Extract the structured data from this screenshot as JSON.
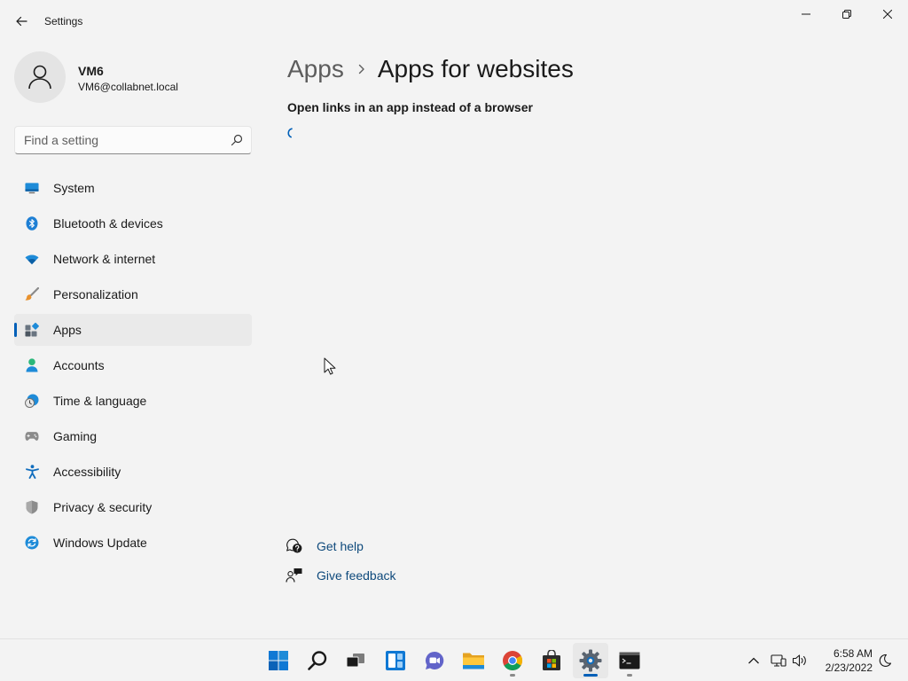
{
  "window": {
    "title": "Settings",
    "back_icon": "arrow-left-icon",
    "controls": [
      "minimize-icon",
      "restore-icon",
      "close-icon"
    ]
  },
  "user": {
    "name": "VM6",
    "email": "VM6@collabnet.local",
    "avatar_icon": "person-icon"
  },
  "search": {
    "placeholder": "Find a setting",
    "icon": "search-icon"
  },
  "sidebar": {
    "selected": "Apps",
    "items": [
      {
        "label": "System",
        "icon": "system-icon"
      },
      {
        "label": "Bluetooth & devices",
        "icon": "bluetooth-icon"
      },
      {
        "label": "Network & internet",
        "icon": "wifi-icon"
      },
      {
        "label": "Personalization",
        "icon": "brush-icon"
      },
      {
        "label": "Apps",
        "icon": "apps-icon"
      },
      {
        "label": "Accounts",
        "icon": "accounts-icon"
      },
      {
        "label": "Time & language",
        "icon": "clock-globe-icon"
      },
      {
        "label": "Gaming",
        "icon": "gamepad-icon"
      },
      {
        "label": "Accessibility",
        "icon": "accessibility-icon"
      },
      {
        "label": "Privacy & security",
        "icon": "shield-icon"
      },
      {
        "label": "Windows Update",
        "icon": "update-icon"
      }
    ]
  },
  "main": {
    "breadcrumb_parent": "Apps",
    "breadcrumb_current": "Apps for websites",
    "subtitle": "Open links in an app instead of a browser",
    "loading": true,
    "help_links": [
      {
        "label": "Get help",
        "icon": "help-icon"
      },
      {
        "label": "Give feedback",
        "icon": "feedback-icon"
      }
    ]
  },
  "taskbar": {
    "apps": [
      {
        "name": "Start",
        "icon": "windows-start-icon",
        "running": false,
        "active": false
      },
      {
        "name": "Search",
        "icon": "search-icon",
        "running": false,
        "active": false
      },
      {
        "name": "Task View",
        "icon": "task-view-icon",
        "running": false,
        "active": false
      },
      {
        "name": "Widgets",
        "icon": "widgets-icon",
        "running": false,
        "active": false
      },
      {
        "name": "Chat",
        "icon": "chat-icon",
        "running": false,
        "active": false
      },
      {
        "name": "File Explorer",
        "icon": "folder-icon",
        "running": false,
        "active": false
      },
      {
        "name": "Chrome",
        "icon": "chrome-icon",
        "running": true,
        "active": false
      },
      {
        "name": "Microsoft Store",
        "icon": "store-icon",
        "running": false,
        "active": false
      },
      {
        "name": "Settings",
        "icon": "gear-icon",
        "running": true,
        "active": true
      },
      {
        "name": "Command Prompt",
        "icon": "terminal-icon",
        "running": true,
        "active": false
      }
    ],
    "tray": [
      "chevron-up-icon",
      "network-icon",
      "volume-icon"
    ],
    "time": "6:58 AM",
    "date": "2/23/2022",
    "focus_icon": "moon-icon"
  },
  "colors": {
    "accent": "#005fb8",
    "background": "#f3f3f3",
    "selected_nav": "#eaeaea",
    "link": "#0f4a7c"
  }
}
